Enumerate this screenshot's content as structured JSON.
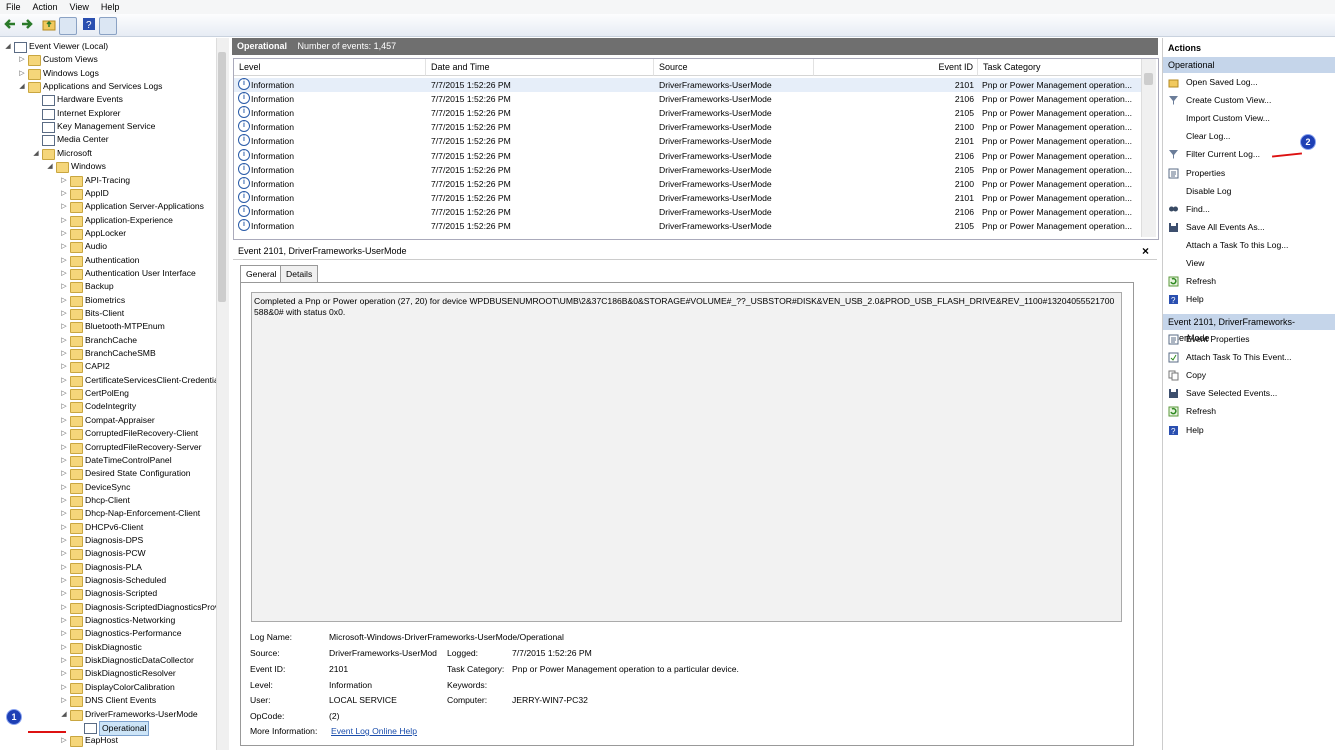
{
  "menu": [
    "File",
    "Action",
    "View",
    "Help"
  ],
  "tree": [
    {
      "label": "Event Viewer (Local)",
      "depth": 0,
      "arrow": "down",
      "icon": "computer-icon"
    },
    {
      "label": "Custom Views",
      "depth": 1,
      "arrow": "right",
      "icon": "folder-icon"
    },
    {
      "label": "Windows Logs",
      "depth": 1,
      "arrow": "right",
      "icon": "folder-icon"
    },
    {
      "label": "Applications and Services Logs",
      "depth": 1,
      "arrow": "down",
      "icon": "folder-icon"
    },
    {
      "label": "Hardware Events",
      "depth": 2,
      "arrow": "",
      "icon": "log-icon"
    },
    {
      "label": "Internet Explorer",
      "depth": 2,
      "arrow": "",
      "icon": "log-icon"
    },
    {
      "label": "Key Management Service",
      "depth": 2,
      "arrow": "",
      "icon": "log-icon"
    },
    {
      "label": "Media Center",
      "depth": 2,
      "arrow": "",
      "icon": "log-icon"
    },
    {
      "label": "Microsoft",
      "depth": 2,
      "arrow": "down",
      "icon": "folder-icon"
    },
    {
      "label": "Windows",
      "depth": 3,
      "arrow": "down",
      "icon": "folder-icon"
    },
    {
      "label": "API-Tracing",
      "depth": 4,
      "arrow": "right",
      "icon": "folder-icon"
    },
    {
      "label": "AppID",
      "depth": 4,
      "arrow": "right",
      "icon": "folder-icon"
    },
    {
      "label": "Application Server-Applications",
      "depth": 4,
      "arrow": "right",
      "icon": "folder-icon"
    },
    {
      "label": "Application-Experience",
      "depth": 4,
      "arrow": "right",
      "icon": "folder-icon"
    },
    {
      "label": "AppLocker",
      "depth": 4,
      "arrow": "right",
      "icon": "folder-icon"
    },
    {
      "label": "Audio",
      "depth": 4,
      "arrow": "right",
      "icon": "folder-icon"
    },
    {
      "label": "Authentication",
      "depth": 4,
      "arrow": "right",
      "icon": "folder-icon"
    },
    {
      "label": "Authentication User Interface",
      "depth": 4,
      "arrow": "right",
      "icon": "folder-icon"
    },
    {
      "label": "Backup",
      "depth": 4,
      "arrow": "right",
      "icon": "folder-icon"
    },
    {
      "label": "Biometrics",
      "depth": 4,
      "arrow": "right",
      "icon": "folder-icon"
    },
    {
      "label": "Bits-Client",
      "depth": 4,
      "arrow": "right",
      "icon": "folder-icon"
    },
    {
      "label": "Bluetooth-MTPEnum",
      "depth": 4,
      "arrow": "right",
      "icon": "folder-icon"
    },
    {
      "label": "BranchCache",
      "depth": 4,
      "arrow": "right",
      "icon": "folder-icon"
    },
    {
      "label": "BranchCacheSMB",
      "depth": 4,
      "arrow": "right",
      "icon": "folder-icon"
    },
    {
      "label": "CAPI2",
      "depth": 4,
      "arrow": "right",
      "icon": "folder-icon"
    },
    {
      "label": "CertificateServicesClient-Credentiall",
      "depth": 4,
      "arrow": "right",
      "icon": "folder-icon"
    },
    {
      "label": "CertPolEng",
      "depth": 4,
      "arrow": "right",
      "icon": "folder-icon"
    },
    {
      "label": "CodeIntegrity",
      "depth": 4,
      "arrow": "right",
      "icon": "folder-icon"
    },
    {
      "label": "Compat-Appraiser",
      "depth": 4,
      "arrow": "right",
      "icon": "folder-icon"
    },
    {
      "label": "CorruptedFileRecovery-Client",
      "depth": 4,
      "arrow": "right",
      "icon": "folder-icon"
    },
    {
      "label": "CorruptedFileRecovery-Server",
      "depth": 4,
      "arrow": "right",
      "icon": "folder-icon"
    },
    {
      "label": "DateTimeControlPanel",
      "depth": 4,
      "arrow": "right",
      "icon": "folder-icon"
    },
    {
      "label": "Desired State Configuration",
      "depth": 4,
      "arrow": "right",
      "icon": "folder-icon"
    },
    {
      "label": "DeviceSync",
      "depth": 4,
      "arrow": "right",
      "icon": "folder-icon"
    },
    {
      "label": "Dhcp-Client",
      "depth": 4,
      "arrow": "right",
      "icon": "folder-icon"
    },
    {
      "label": "Dhcp-Nap-Enforcement-Client",
      "depth": 4,
      "arrow": "right",
      "icon": "folder-icon"
    },
    {
      "label": "DHCPv6-Client",
      "depth": 4,
      "arrow": "right",
      "icon": "folder-icon"
    },
    {
      "label": "Diagnosis-DPS",
      "depth": 4,
      "arrow": "right",
      "icon": "folder-icon"
    },
    {
      "label": "Diagnosis-PCW",
      "depth": 4,
      "arrow": "right",
      "icon": "folder-icon"
    },
    {
      "label": "Diagnosis-PLA",
      "depth": 4,
      "arrow": "right",
      "icon": "folder-icon"
    },
    {
      "label": "Diagnosis-Scheduled",
      "depth": 4,
      "arrow": "right",
      "icon": "folder-icon"
    },
    {
      "label": "Diagnosis-Scripted",
      "depth": 4,
      "arrow": "right",
      "icon": "folder-icon"
    },
    {
      "label": "Diagnosis-ScriptedDiagnosticsProvi",
      "depth": 4,
      "arrow": "right",
      "icon": "folder-icon"
    },
    {
      "label": "Diagnostics-Networking",
      "depth": 4,
      "arrow": "right",
      "icon": "folder-icon"
    },
    {
      "label": "Diagnostics-Performance",
      "depth": 4,
      "arrow": "right",
      "icon": "folder-icon"
    },
    {
      "label": "DiskDiagnostic",
      "depth": 4,
      "arrow": "right",
      "icon": "folder-icon"
    },
    {
      "label": "DiskDiagnosticDataCollector",
      "depth": 4,
      "arrow": "right",
      "icon": "folder-icon"
    },
    {
      "label": "DiskDiagnosticResolver",
      "depth": 4,
      "arrow": "right",
      "icon": "folder-icon"
    },
    {
      "label": "DisplayColorCalibration",
      "depth": 4,
      "arrow": "right",
      "icon": "folder-icon"
    },
    {
      "label": "DNS Client Events",
      "depth": 4,
      "arrow": "right",
      "icon": "folder-icon"
    },
    {
      "label": "DriverFrameworks-UserMode",
      "depth": 4,
      "arrow": "down",
      "icon": "folder-icon"
    },
    {
      "label": "Operational",
      "depth": 5,
      "arrow": "",
      "icon": "log-icon",
      "selected": true
    },
    {
      "label": "EapHost",
      "depth": 4,
      "arrow": "right",
      "icon": "folder-icon"
    }
  ],
  "header": {
    "title": "Operational",
    "count": "Number of events: 1,457"
  },
  "columns": [
    "Level",
    "Date and Time",
    "Source",
    "Event ID",
    "Task Category"
  ],
  "events": [
    {
      "level": "Information",
      "date": "7/7/2015 1:52:26 PM",
      "source": "DriverFrameworks-UserMode",
      "id": "2101",
      "task": "Pnp or Power Management operation..."
    },
    {
      "level": "Information",
      "date": "7/7/2015 1:52:26 PM",
      "source": "DriverFrameworks-UserMode",
      "id": "2106",
      "task": "Pnp or Power Management operation..."
    },
    {
      "level": "Information",
      "date": "7/7/2015 1:52:26 PM",
      "source": "DriverFrameworks-UserMode",
      "id": "2105",
      "task": "Pnp or Power Management operation..."
    },
    {
      "level": "Information",
      "date": "7/7/2015 1:52:26 PM",
      "source": "DriverFrameworks-UserMode",
      "id": "2100",
      "task": "Pnp or Power Management operation..."
    },
    {
      "level": "Information",
      "date": "7/7/2015 1:52:26 PM",
      "source": "DriverFrameworks-UserMode",
      "id": "2101",
      "task": "Pnp or Power Management operation..."
    },
    {
      "level": "Information",
      "date": "7/7/2015 1:52:26 PM",
      "source": "DriverFrameworks-UserMode",
      "id": "2106",
      "task": "Pnp or Power Management operation..."
    },
    {
      "level": "Information",
      "date": "7/7/2015 1:52:26 PM",
      "source": "DriverFrameworks-UserMode",
      "id": "2105",
      "task": "Pnp or Power Management operation..."
    },
    {
      "level": "Information",
      "date": "7/7/2015 1:52:26 PM",
      "source": "DriverFrameworks-UserMode",
      "id": "2100",
      "task": "Pnp or Power Management operation..."
    },
    {
      "level": "Information",
      "date": "7/7/2015 1:52:26 PM",
      "source": "DriverFrameworks-UserMode",
      "id": "2101",
      "task": "Pnp or Power Management operation..."
    },
    {
      "level": "Information",
      "date": "7/7/2015 1:52:26 PM",
      "source": "DriverFrameworks-UserMode",
      "id": "2106",
      "task": "Pnp or Power Management operation..."
    },
    {
      "level": "Information",
      "date": "7/7/2015 1:52:26 PM",
      "source": "DriverFrameworks-UserMode",
      "id": "2105",
      "task": "Pnp or Power Management operation..."
    }
  ],
  "detail": {
    "title": "Event 2101, DriverFrameworks-UserMode",
    "close": "×",
    "tabs": [
      "General",
      "Details"
    ],
    "message": "Completed a Pnp or Power operation (27, 20) for device WPDBUSENUMROOT\\UMB\\2&37C186B&0&STORAGE#VOLUME#_??_USBSTOR#DISK&VEN_USB_2.0&PROD_USB_FLASH_DRIVE&REV_1100#13204055521700588&0# with status 0x0.",
    "fields": {
      "log_name_label": "Log Name:",
      "log_name": "Microsoft-Windows-DriverFrameworks-UserMode/Operational",
      "source_label": "Source:",
      "source": "DriverFrameworks-UserMod",
      "logged_label": "Logged:",
      "logged": "7/7/2015 1:52:26 PM",
      "event_id_label": "Event ID:",
      "event_id": "2101",
      "task_label": "Task Category:",
      "task": "Pnp or Power Management operation to a particular device.",
      "level_label": "Level:",
      "level": "Information",
      "keywords_label": "Keywords:",
      "user_label": "User:",
      "user": "LOCAL SERVICE",
      "computer_label": "Computer:",
      "computer": "JERRY-WIN7-PC32",
      "opcode_label": "OpCode:",
      "opcode": "(2)",
      "more_label": "More Information:",
      "more_link": "Event Log Online Help"
    }
  },
  "actions": {
    "title": "Actions",
    "section1": "Operational",
    "items1": [
      {
        "label": "Open Saved Log...",
        "icon": "open-folder-icon"
      },
      {
        "label": "Create Custom View...",
        "icon": "filter-icon"
      },
      {
        "label": "Import Custom View...",
        "icon": ""
      },
      {
        "label": "Clear Log...",
        "icon": ""
      },
      {
        "label": "Filter Current Log...",
        "icon": "filter-icon"
      },
      {
        "label": "Properties",
        "icon": "properties-icon"
      },
      {
        "label": "Disable Log",
        "icon": ""
      },
      {
        "label": "Find...",
        "icon": "find-icon"
      },
      {
        "label": "Save All Events As...",
        "icon": "save-icon"
      },
      {
        "label": "Attach a Task To this Log...",
        "icon": ""
      },
      {
        "label": "View",
        "icon": ""
      },
      {
        "label": "Refresh",
        "icon": "refresh-icon"
      },
      {
        "label": "Help",
        "icon": "help-icon"
      }
    ],
    "section2": "Event 2101, DriverFrameworks-UserMode",
    "items2": [
      {
        "label": "Event Properties",
        "icon": "properties-icon"
      },
      {
        "label": "Attach Task To This Event...",
        "icon": "task-icon"
      },
      {
        "label": "Copy",
        "icon": "copy-icon"
      },
      {
        "label": "Save Selected Events...",
        "icon": "save-icon"
      },
      {
        "label": "Refresh",
        "icon": "refresh-icon"
      },
      {
        "label": "Help",
        "icon": "help-icon"
      }
    ]
  },
  "badges": {
    "one": "1",
    "two": "2"
  },
  "colors": {
    "accent": "#c5d5ea",
    "header_bg": "#6f6f6f",
    "link": "#1a4dab",
    "annotation": "#d11111",
    "badge": "#1d3fb5"
  }
}
